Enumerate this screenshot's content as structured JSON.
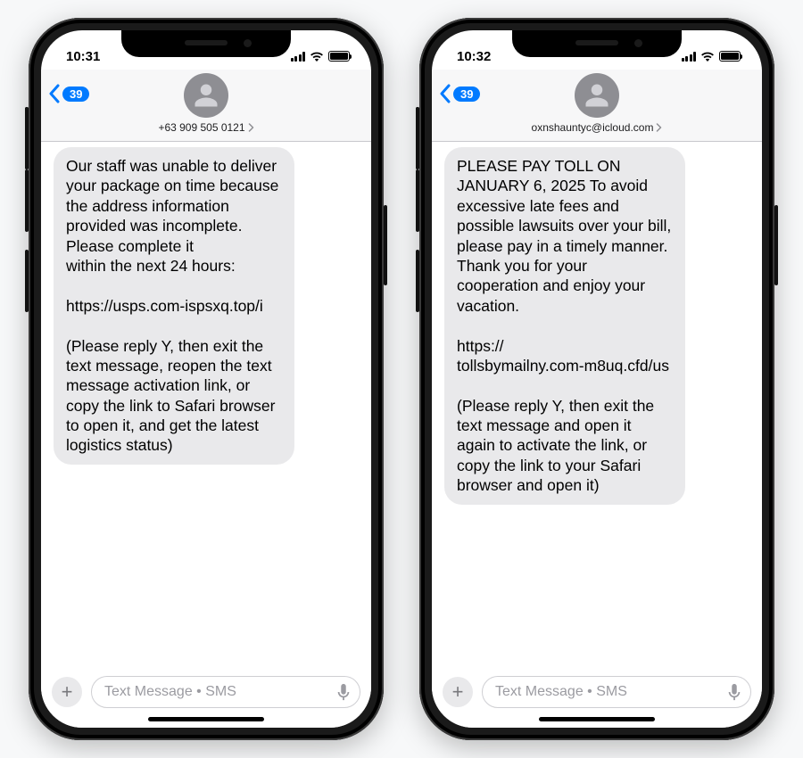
{
  "phones": [
    {
      "status": {
        "time": "10:31"
      },
      "header": {
        "back_count": "39",
        "sender": "+63 909 505 0121"
      },
      "message": "Our staff was unable to deliver your package on time because the address information provided was incomplete. Please complete it\nwithin the next 24 hours:\n\nhttps://usps.com-ispsxq.top/i\n\n(Please reply Y, then exit the text message, reopen the text message activation link, or copy the link to Safari browser to open it, and get the latest logistics status)",
      "input_placeholder": "Text Message • SMS"
    },
    {
      "status": {
        "time": "10:32"
      },
      "header": {
        "back_count": "39",
        "sender": "oxnshauntyc@icloud.com"
      },
      "message": "PLEASE PAY TOLL ON JANUARY 6, 2025 To avoid excessive late fees and possible lawsuits over your bill, please pay in a timely manner. Thank you for your cooperation and enjoy your vacation.\n\nhttps://\ntollsbymailny.com-m8uq.cfd/us\n\n(Please reply Y, then exit the text message and open it again to activate the link, or copy the link to your Safari browser and open it)",
      "input_placeholder": "Text Message • SMS"
    }
  ]
}
